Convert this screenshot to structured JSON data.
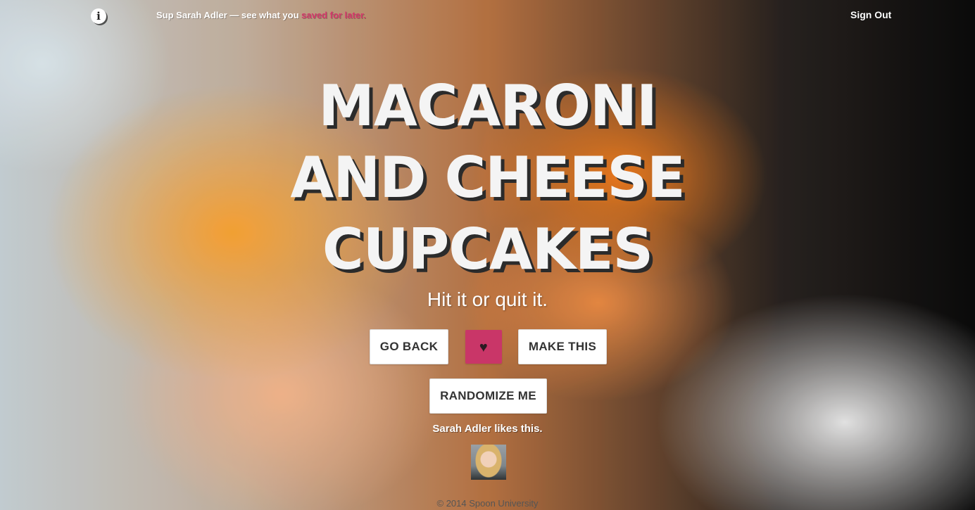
{
  "topbar": {
    "info_icon": "info-icon",
    "greeting_prefix": "Sup Sarah Adler — see what you ",
    "greeting_link": "saved for later.",
    "sign_out": "Sign Out"
  },
  "hero": {
    "title_lines": [
      "MACARONI",
      "AND CHEESE",
      "CUPCAKES"
    ],
    "subtitle": "Hit it or quit it."
  },
  "actions": {
    "go_back": "GO BACK",
    "heart": "♥",
    "make_this": "MAKE THIS",
    "randomize": "RANDOMIZE ME"
  },
  "social": {
    "likes_text": "Sarah Adler likes this."
  },
  "footer": {
    "copyright": "© 2014 Spoon University"
  },
  "colors": {
    "accent": "#c93668",
    "link": "#d4376a",
    "title_shadow": "#2b2b2b"
  }
}
